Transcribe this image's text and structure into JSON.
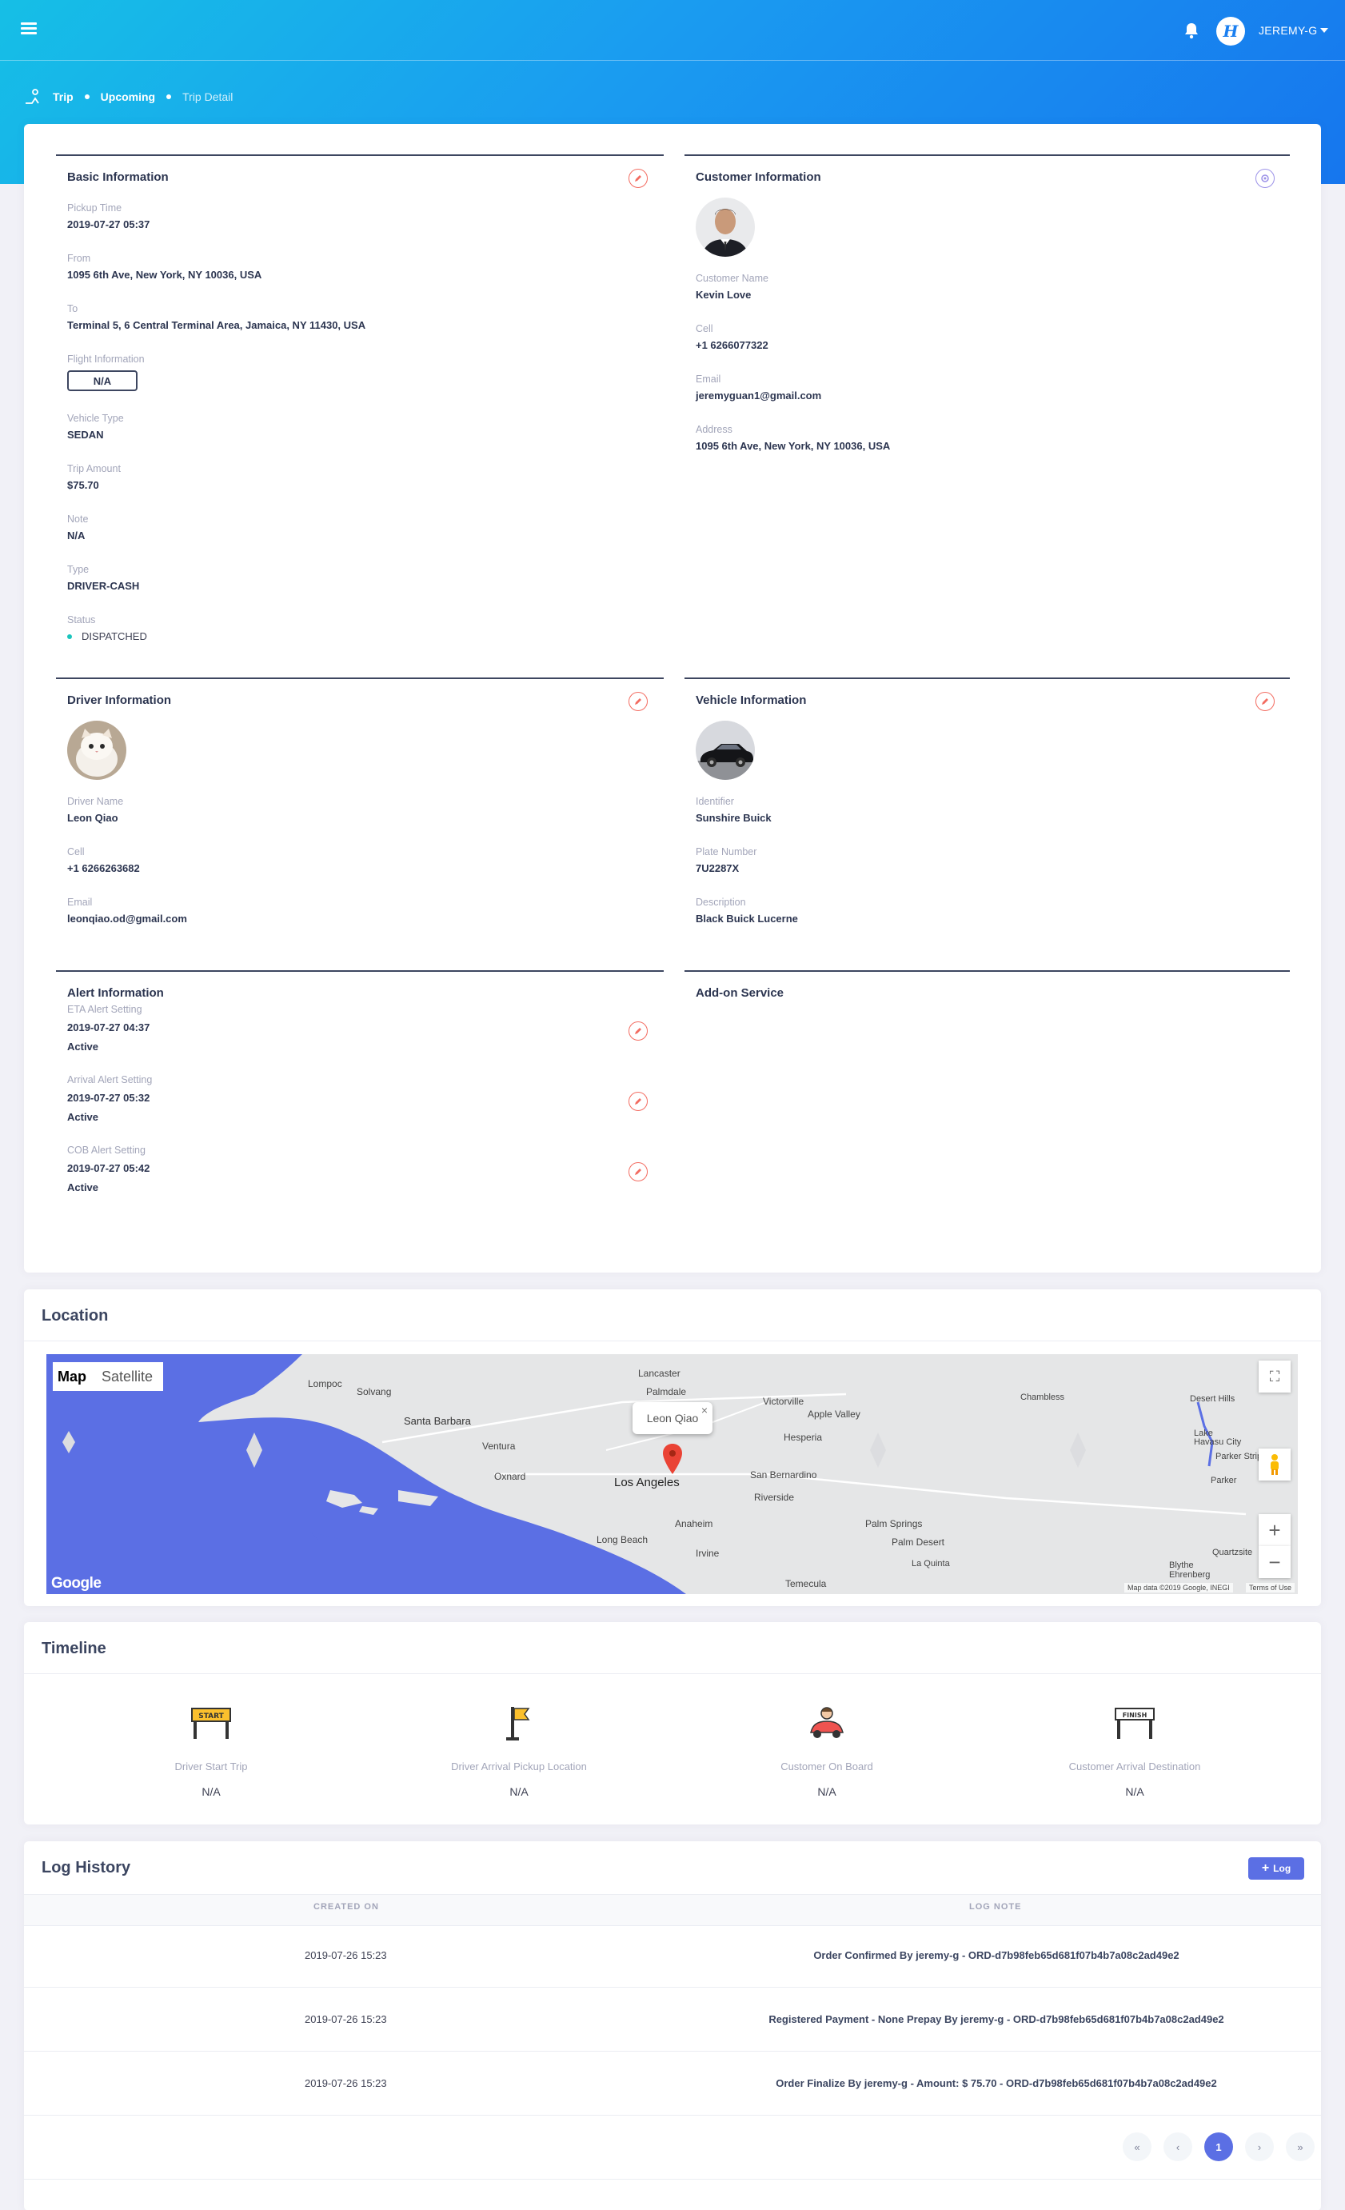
{
  "nav": {
    "user_name": "JEREMY-G",
    "logo_letter": "H"
  },
  "breadcrumb": {
    "items": [
      "Trip",
      "Upcoming",
      "Trip Detail"
    ]
  },
  "basic": {
    "title": "Basic Information",
    "pickup_label": "Pickup Time",
    "pickup_value": "2019-07-27 05:37",
    "from_label": "From",
    "from_value": "1095 6th Ave, New York, NY 10036, USA",
    "to_label": "To",
    "to_value": "Terminal 5, 6 Central Terminal Area, Jamaica, NY 11430, USA",
    "flight_label": "Flight Information",
    "flight_value": "N/A",
    "vehicle_type_label": "Vehicle Type",
    "vehicle_type_value": "SEDAN",
    "amount_label": "Trip Amount",
    "amount_value": "$75.70",
    "note_label": "Note",
    "note_value": "N/A",
    "type_label": "Type",
    "type_value": "DRIVER-CASH",
    "status_label": "Status",
    "status_value": "DISPATCHED"
  },
  "customer": {
    "title": "Customer Information",
    "name_label": "Customer Name",
    "name_value": "Kevin Love",
    "cell_label": "Cell",
    "cell_value": "+1 6266077322",
    "email_label": "Email",
    "email_value": "jeremyguan1@gmail.com",
    "address_label": "Address",
    "address_value": "1095 6th Ave, New York, NY 10036, USA"
  },
  "driver": {
    "title": "Driver Information",
    "name_label": "Driver Name",
    "name_value": "Leon Qiao",
    "cell_label": "Cell",
    "cell_value": "+1 6266263682",
    "email_label": "Email",
    "email_value": "leonqiao.od@gmail.com"
  },
  "vehicle": {
    "title": "Vehicle Information",
    "identifier_label": "Identifier",
    "identifier_value": "Sunshire Buick",
    "plate_label": "Plate Number",
    "plate_value": "7U2287X",
    "desc_label": "Description",
    "desc_value": "Black Buick Lucerne"
  },
  "alert": {
    "title": "Alert Information",
    "items": [
      {
        "label": "ETA Alert Setting",
        "time": "2019-07-27 04:37",
        "state": "Active"
      },
      {
        "label": "Arrival Alert Setting",
        "time": "2019-07-27 05:32",
        "state": "Active"
      },
      {
        "label": "COB Alert Setting",
        "time": "2019-07-27 05:42",
        "state": "Active"
      }
    ]
  },
  "addon": {
    "title": "Add-on Service"
  },
  "location": {
    "title": "Location",
    "map_tab": "Map",
    "satellite_tab": "Satellite",
    "marker_label": "Leon Qiao",
    "places": [
      "Lancaster",
      "Palmdale",
      "Lompoc",
      "Solvang",
      "Santa Barbara",
      "Ventura",
      "Oxnard",
      "Los Angeles",
      "Victorville",
      "Apple Valley",
      "Hesperia",
      "San Bernardino",
      "Riverside",
      "Anaheim",
      "Long Beach",
      "Irvine",
      "Temecula",
      "Palm Springs",
      "Palm Desert",
      "La Quinta",
      "Chambless",
      "Desert Hills",
      "Lake Havasu City",
      "Parker Strip",
      "Parker",
      "Blythe",
      "Quartzsite",
      "Ehrenberg"
    ],
    "google": "Google",
    "attribution": "Map data ©2019 Google, INEGI",
    "terms": "Terms of Use"
  },
  "timeline": {
    "title": "Timeline",
    "items": [
      {
        "label": "Driver Start Trip",
        "value": "N/A",
        "icon_text": "START"
      },
      {
        "label": "Driver Arrival Pickup Location",
        "value": "N/A"
      },
      {
        "label": "Customer On Board",
        "value": "N/A"
      },
      {
        "label": "Customer Arrival Destination",
        "value": "N/A",
        "icon_text": "FINISH"
      }
    ]
  },
  "log": {
    "title": "Log History",
    "add_label": "Log",
    "columns": [
      "CREATED ON",
      "LOG NOTE"
    ],
    "rows": [
      {
        "created": "2019-07-26 15:23",
        "note": "Order Confirmed By jeremy-g - ORD-d7b98feb65d681f07b4b7a08c2ad49e2"
      },
      {
        "created": "2019-07-26 15:23",
        "note": "Registered Payment - None Prepay By jeremy-g - ORD-d7b98feb65d681f07b4b7a08c2ad49e2"
      },
      {
        "created": "2019-07-26 15:23",
        "note": "Order Finalize By jeremy-g - Amount: $ 75.70 - ORD-d7b98feb65d681f07b4b7a08c2ad49e2"
      }
    ],
    "pagination": {
      "first": "«",
      "prev": "‹",
      "current": "1",
      "next": "›",
      "last": "»"
    }
  }
}
